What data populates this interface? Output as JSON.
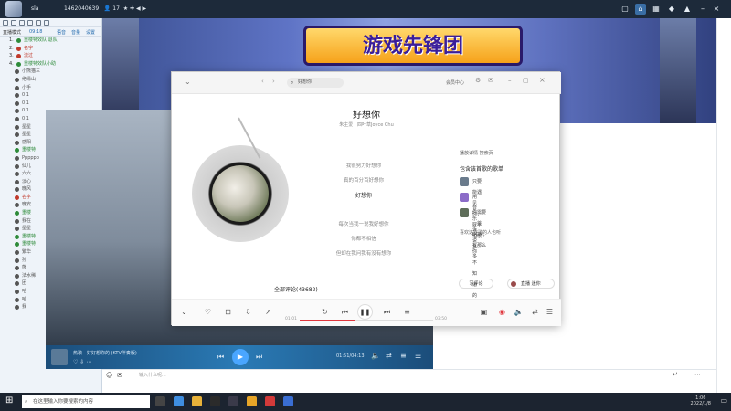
{
  "topbar": {
    "title": "sla",
    "id_label": "1462040639",
    "count": "17"
  },
  "left": {
    "header_left": "直播模式",
    "header_time": "09:18",
    "tools": [
      "语音",
      "音量",
      "设置"
    ],
    "rows": [
      {
        "num": "1.",
        "name": "重楼特效队 退队",
        "color": "#2e8b3a"
      },
      {
        "num": "2.",
        "name": "名字",
        "color": "#c0392b"
      },
      {
        "num": "3.",
        "name": "流过",
        "color": "#c0392b"
      },
      {
        "num": "4.",
        "name": "重楼特效队小助",
        "color": "#2e8b3a"
      },
      {
        "num": "",
        "name": "小熊猫三",
        "color": "#555"
      },
      {
        "num": "",
        "name": "绝缘山",
        "color": "#555"
      },
      {
        "num": "",
        "name": "小手",
        "color": "#555"
      },
      {
        "num": "",
        "name": "0 1",
        "color": "#555"
      },
      {
        "num": "",
        "name": "0 1",
        "color": "#555"
      },
      {
        "num": "",
        "name": "0 1",
        "color": "#555"
      },
      {
        "num": "",
        "name": "0 1",
        "color": "#555"
      },
      {
        "num": "",
        "name": "星星",
        "color": "#555"
      },
      {
        "num": "",
        "name": "星星",
        "color": "#555"
      },
      {
        "num": "",
        "name": "感阳",
        "color": "#555"
      },
      {
        "num": "",
        "name": "重楼特",
        "color": "#2e8b3a"
      },
      {
        "num": "",
        "name": "Pppppp",
        "color": "#555"
      },
      {
        "num": "",
        "name": "仙儿",
        "color": "#555"
      },
      {
        "num": "",
        "name": "六六",
        "color": "#555"
      },
      {
        "num": "",
        "name": "淡心",
        "color": "#555"
      },
      {
        "num": "",
        "name": "晚风",
        "color": "#555"
      },
      {
        "num": "",
        "name": "名字",
        "color": "#c0392b"
      },
      {
        "num": "",
        "name": "晚安",
        "color": "#555"
      },
      {
        "num": "",
        "name": "重楼",
        "color": "#2e8b3a"
      },
      {
        "num": "",
        "name": "我在",
        "color": "#555"
      },
      {
        "num": "",
        "name": "星星",
        "color": "#555"
      },
      {
        "num": "",
        "name": "重楼特",
        "color": "#2e8b3a"
      },
      {
        "num": "",
        "name": "重楼特",
        "color": "#2e8b3a"
      },
      {
        "num": "",
        "name": "繁华",
        "color": "#555"
      },
      {
        "num": "",
        "name": "孙",
        "color": "#555"
      },
      {
        "num": "",
        "name": "熊",
        "color": "#555"
      },
      {
        "num": "",
        "name": "法水稀",
        "color": "#555"
      },
      {
        "num": "",
        "name": "团",
        "color": "#555"
      },
      {
        "num": "",
        "name": "哈",
        "color": "#555"
      },
      {
        "num": "",
        "name": "哈",
        "color": "#555"
      },
      {
        "num": "",
        "name": "我",
        "color": "#555"
      }
    ]
  },
  "stream": {
    "banner": "游戏先锋团"
  },
  "music": {
    "search_text": "好想你",
    "account_label": "会员中心",
    "song_title": "好想你",
    "song_sub": "朱主爱 · 四叶草Joyce Chu",
    "lyrics": [
      {
        "text": "",
        "active": false
      },
      {
        "text": "我很努力好想你",
        "active": false
      },
      {
        "text": "真的百分百好想你",
        "active": false
      },
      {
        "text": "好想你",
        "active": true
      },
      {
        "text": "",
        "active": false
      },
      {
        "text": "每次当我一说我好想你",
        "active": false
      },
      {
        "text": "你都不相信",
        "active": false
      },
      {
        "text": "但却在我问我有没有想你",
        "active": false
      }
    ],
    "comments_label": "全部评论(43682)",
    "play_hint": "播放详情  搜索页",
    "intro_title": "包含该首歌的歌单",
    "playlists": [
      "只要能遇见你，就不怕很多",
      "用音乐诉说你不知道的心",
      "你需要一首BGM，有那么多"
    ],
    "more_like": "喜欢这首歌的人也听",
    "btn_comment": "写评论",
    "btn_mini": "直播 迷你",
    "time_current": "01:01",
    "time_total": "03:50",
    "progress": 0.41
  },
  "mini_player": {
    "title": "热歌 - 好好想你的 (KTV伴奏版)",
    "time": "01:51/04:13"
  },
  "chat": {
    "placeholder": "输入什么呢..."
  },
  "taskbar": {
    "search_placeholder": "在这里输入你要搜索的内容",
    "time": "1:06",
    "date": "2022/1/8"
  }
}
